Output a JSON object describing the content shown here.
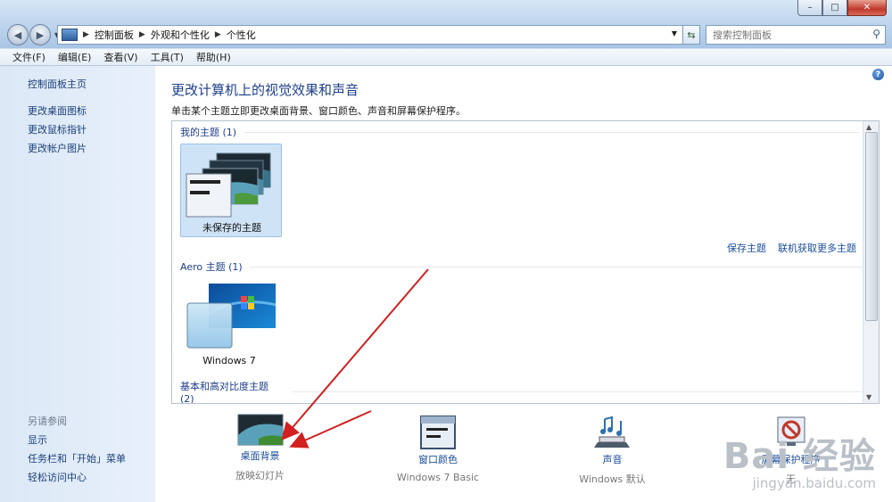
{
  "window": {
    "controls": {
      "minimize": "–",
      "maximize": "□",
      "close": "✕"
    }
  },
  "address": {
    "crumbs": [
      "控制面板",
      "外观和个性化",
      "个性化"
    ]
  },
  "search": {
    "placeholder": "搜索控制面板"
  },
  "menu": [
    "文件(F)",
    "编辑(E)",
    "查看(V)",
    "工具(T)",
    "帮助(H)"
  ],
  "sidebar": {
    "links": [
      "控制面板主页",
      "更改桌面图标",
      "更改鼠标指针",
      "更改帐户图片"
    ],
    "see_also_title": "另请参阅",
    "see_also": [
      "显示",
      "任务栏和「开始」菜单",
      "轻松访问中心"
    ]
  },
  "main": {
    "title": "更改计算机上的视觉效果和声音",
    "description": "单击某个主题立即更改桌面背景、窗口颜色、声音和屏幕保护程序。",
    "groups": [
      {
        "title": "我的主题 (1)",
        "themes": [
          {
            "name": "未保存的主题",
            "selected": true
          }
        ]
      },
      {
        "title": "Aero 主题 (1)",
        "themes": [
          {
            "name": "Windows 7",
            "selected": false
          }
        ]
      },
      {
        "title": "基本和高对比度主题 (2)",
        "themes": []
      }
    ],
    "save_theme": "保存主题",
    "get_more": "联机获取更多主题"
  },
  "bottom": [
    {
      "label": "桌面背景",
      "sub": "放映幻灯片",
      "icon": "desktop-background-icon"
    },
    {
      "label": "窗口颜色",
      "sub": "Windows 7 Basic",
      "icon": "window-color-icon"
    },
    {
      "label": "声音",
      "sub": "Windows 默认",
      "icon": "sound-icon"
    },
    {
      "label": "屏幕保护程序",
      "sub": "无",
      "icon": "screensaver-icon"
    }
  ],
  "watermark": {
    "main": "Bai 经验",
    "sub": "jingyan.baidu.com"
  },
  "colors": {
    "link": "#1a4c9a",
    "title": "#1e3f8a",
    "arrow": "#d21f1f"
  }
}
